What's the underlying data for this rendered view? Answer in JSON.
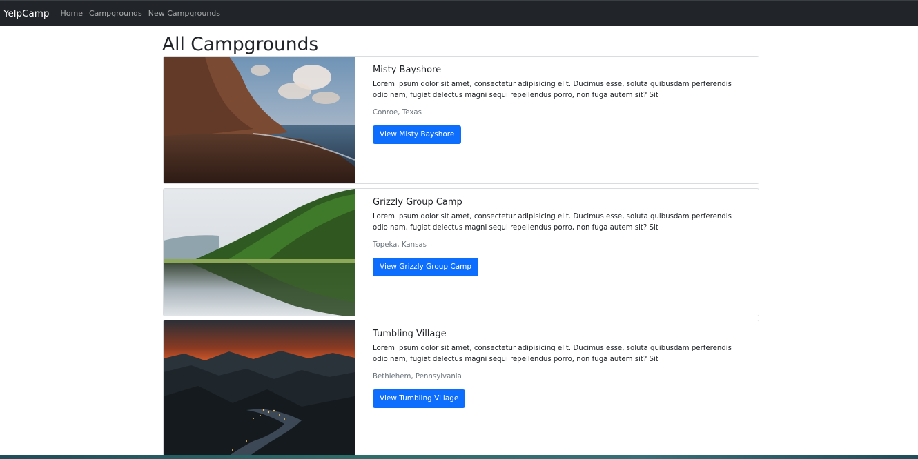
{
  "navbar": {
    "brand": "YelpCamp",
    "links": [
      "Home",
      "Campgrounds",
      "New Campgrounds"
    ]
  },
  "page": {
    "title": "All Campgrounds"
  },
  "campgrounds": [
    {
      "title": "Misty Bayshore",
      "description": "Lorem ipsum dolor sit amet, consectetur adipisicing elit. Ducimus esse, soluta quibusdam perferendis odio nam, fugiat delectus magni sequi repellendus porro, non fuga autem sit? Sit",
      "location": "Conroe, Texas",
      "button": "View Misty Bayshore"
    },
    {
      "title": "Grizzly Group Camp",
      "description": "Lorem ipsum dolor sit amet, consectetur adipisicing elit. Ducimus esse, soluta quibusdam perferendis odio nam, fugiat delectus magni sequi repellendus porro, non fuga autem sit? Sit",
      "location": "Topeka, Kansas",
      "button": "View Grizzly Group Camp"
    },
    {
      "title": "Tumbling Village",
      "description": "Lorem ipsum dolor sit amet, consectetur adipisicing elit. Ducimus esse, soluta quibusdam perferendis odio nam, fugiat delectus magni sequi repellendus porro, non fuga autem sit? Sit",
      "location": "Bethlehem, Pennsylvania",
      "button": "View Tumbling Village"
    }
  ],
  "colors": {
    "navbar_bg": "#212529",
    "primary": "#0d6efd",
    "muted": "#6c757d"
  }
}
